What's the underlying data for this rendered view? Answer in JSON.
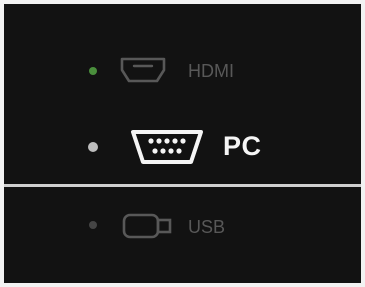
{
  "sources": [
    {
      "label": "HDMI",
      "icon": "hdmi-port-icon",
      "selected": false,
      "dot_color": "#4a8f3c",
      "text_color": "#585858"
    },
    {
      "label": "PC",
      "icon": "vga-port-icon",
      "selected": true,
      "dot_color": "#bdbdbd",
      "text_color": "#f5f5f5"
    },
    {
      "label": "USB",
      "icon": "usb-port-icon",
      "selected": false,
      "dot_color": "#454545",
      "text_color": "#585858"
    }
  ],
  "colors": {
    "background": "#121212",
    "divider": "#cfcfcf"
  }
}
